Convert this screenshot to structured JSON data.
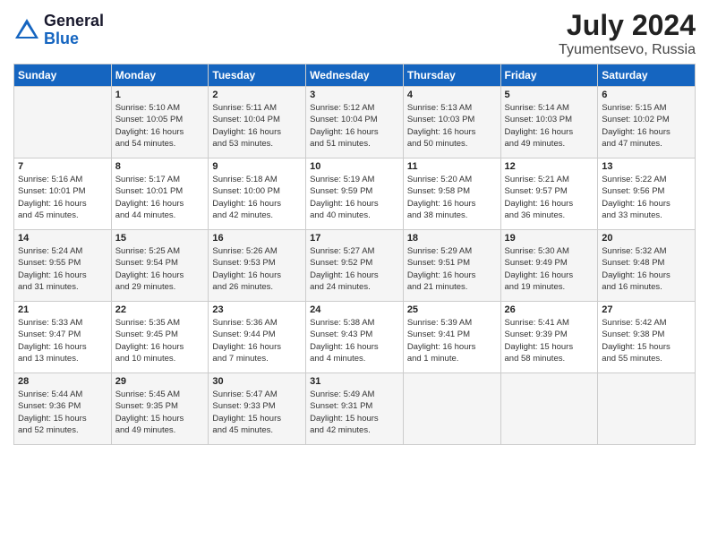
{
  "header": {
    "logo_general": "General",
    "logo_blue": "Blue",
    "month_year": "July 2024",
    "location": "Tyumentsevo, Russia"
  },
  "weekdays": [
    "Sunday",
    "Monday",
    "Tuesday",
    "Wednesday",
    "Thursday",
    "Friday",
    "Saturday"
  ],
  "weeks": [
    [
      {
        "day": "",
        "info": ""
      },
      {
        "day": "1",
        "info": "Sunrise: 5:10 AM\nSunset: 10:05 PM\nDaylight: 16 hours\nand 54 minutes."
      },
      {
        "day": "2",
        "info": "Sunrise: 5:11 AM\nSunset: 10:04 PM\nDaylight: 16 hours\nand 53 minutes."
      },
      {
        "day": "3",
        "info": "Sunrise: 5:12 AM\nSunset: 10:04 PM\nDaylight: 16 hours\nand 51 minutes."
      },
      {
        "day": "4",
        "info": "Sunrise: 5:13 AM\nSunset: 10:03 PM\nDaylight: 16 hours\nand 50 minutes."
      },
      {
        "day": "5",
        "info": "Sunrise: 5:14 AM\nSunset: 10:03 PM\nDaylight: 16 hours\nand 49 minutes."
      },
      {
        "day": "6",
        "info": "Sunrise: 5:15 AM\nSunset: 10:02 PM\nDaylight: 16 hours\nand 47 minutes."
      }
    ],
    [
      {
        "day": "7",
        "info": "Sunrise: 5:16 AM\nSunset: 10:01 PM\nDaylight: 16 hours\nand 45 minutes."
      },
      {
        "day": "8",
        "info": "Sunrise: 5:17 AM\nSunset: 10:01 PM\nDaylight: 16 hours\nand 44 minutes."
      },
      {
        "day": "9",
        "info": "Sunrise: 5:18 AM\nSunset: 10:00 PM\nDaylight: 16 hours\nand 42 minutes."
      },
      {
        "day": "10",
        "info": "Sunrise: 5:19 AM\nSunset: 9:59 PM\nDaylight: 16 hours\nand 40 minutes."
      },
      {
        "day": "11",
        "info": "Sunrise: 5:20 AM\nSunset: 9:58 PM\nDaylight: 16 hours\nand 38 minutes."
      },
      {
        "day": "12",
        "info": "Sunrise: 5:21 AM\nSunset: 9:57 PM\nDaylight: 16 hours\nand 36 minutes."
      },
      {
        "day": "13",
        "info": "Sunrise: 5:22 AM\nSunset: 9:56 PM\nDaylight: 16 hours\nand 33 minutes."
      }
    ],
    [
      {
        "day": "14",
        "info": "Sunrise: 5:24 AM\nSunset: 9:55 PM\nDaylight: 16 hours\nand 31 minutes."
      },
      {
        "day": "15",
        "info": "Sunrise: 5:25 AM\nSunset: 9:54 PM\nDaylight: 16 hours\nand 29 minutes."
      },
      {
        "day": "16",
        "info": "Sunrise: 5:26 AM\nSunset: 9:53 PM\nDaylight: 16 hours\nand 26 minutes."
      },
      {
        "day": "17",
        "info": "Sunrise: 5:27 AM\nSunset: 9:52 PM\nDaylight: 16 hours\nand 24 minutes."
      },
      {
        "day": "18",
        "info": "Sunrise: 5:29 AM\nSunset: 9:51 PM\nDaylight: 16 hours\nand 21 minutes."
      },
      {
        "day": "19",
        "info": "Sunrise: 5:30 AM\nSunset: 9:49 PM\nDaylight: 16 hours\nand 19 minutes."
      },
      {
        "day": "20",
        "info": "Sunrise: 5:32 AM\nSunset: 9:48 PM\nDaylight: 16 hours\nand 16 minutes."
      }
    ],
    [
      {
        "day": "21",
        "info": "Sunrise: 5:33 AM\nSunset: 9:47 PM\nDaylight: 16 hours\nand 13 minutes."
      },
      {
        "day": "22",
        "info": "Sunrise: 5:35 AM\nSunset: 9:45 PM\nDaylight: 16 hours\nand 10 minutes."
      },
      {
        "day": "23",
        "info": "Sunrise: 5:36 AM\nSunset: 9:44 PM\nDaylight: 16 hours\nand 7 minutes."
      },
      {
        "day": "24",
        "info": "Sunrise: 5:38 AM\nSunset: 9:43 PM\nDaylight: 16 hours\nand 4 minutes."
      },
      {
        "day": "25",
        "info": "Sunrise: 5:39 AM\nSunset: 9:41 PM\nDaylight: 16 hours\nand 1 minute."
      },
      {
        "day": "26",
        "info": "Sunrise: 5:41 AM\nSunset: 9:39 PM\nDaylight: 15 hours\nand 58 minutes."
      },
      {
        "day": "27",
        "info": "Sunrise: 5:42 AM\nSunset: 9:38 PM\nDaylight: 15 hours\nand 55 minutes."
      }
    ],
    [
      {
        "day": "28",
        "info": "Sunrise: 5:44 AM\nSunset: 9:36 PM\nDaylight: 15 hours\nand 52 minutes."
      },
      {
        "day": "29",
        "info": "Sunrise: 5:45 AM\nSunset: 9:35 PM\nDaylight: 15 hours\nand 49 minutes."
      },
      {
        "day": "30",
        "info": "Sunrise: 5:47 AM\nSunset: 9:33 PM\nDaylight: 15 hours\nand 45 minutes."
      },
      {
        "day": "31",
        "info": "Sunrise: 5:49 AM\nSunset: 9:31 PM\nDaylight: 15 hours\nand 42 minutes."
      },
      {
        "day": "",
        "info": ""
      },
      {
        "day": "",
        "info": ""
      },
      {
        "day": "",
        "info": ""
      }
    ]
  ]
}
